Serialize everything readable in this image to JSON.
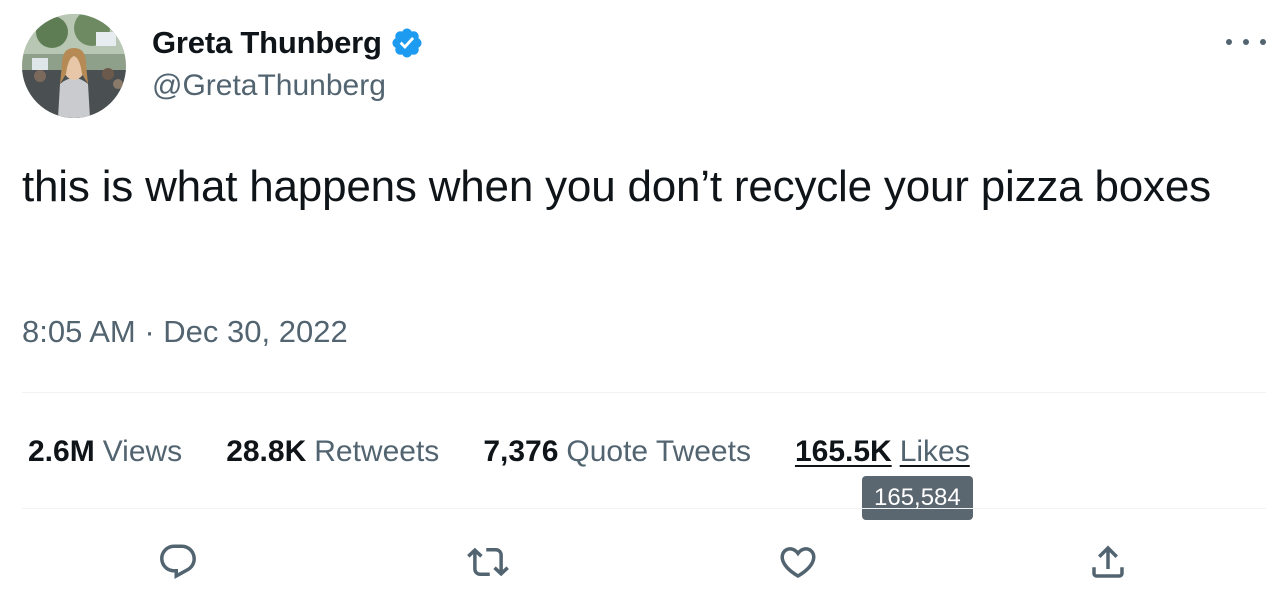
{
  "author": {
    "display_name": "Greta Thunberg",
    "handle": "@GretaThunberg",
    "verified_icon": "verified-badge-icon",
    "avatar": "profile-photo"
  },
  "menu": {
    "icon": "more-options-icon"
  },
  "tweet": {
    "text": "this is what happens when you don’t recycle your pizza boxes",
    "timestamp": "8:05 AM · Dec 30, 2022"
  },
  "stats": {
    "views": {
      "count": "2.6M",
      "label": "Views"
    },
    "retweets": {
      "count": "28.8K",
      "label": "Retweets"
    },
    "quotes": {
      "count": "7,376",
      "label": "Quote Tweets"
    },
    "likes": {
      "count": "165.5K",
      "label": "Likes"
    }
  },
  "tooltip": {
    "text": "165,584"
  },
  "actions": [
    {
      "name": "reply",
      "icon": "reply-icon"
    },
    {
      "name": "retweet",
      "icon": "retweet-icon"
    },
    {
      "name": "like",
      "icon": "heart-icon"
    },
    {
      "name": "share",
      "icon": "share-icon"
    }
  ],
  "colors": {
    "text_primary": "#0f1419",
    "text_secondary": "#536471",
    "divider": "#eff3f4",
    "verified_blue": "#1d9bf0",
    "tooltip_bg": "#5b6770"
  }
}
